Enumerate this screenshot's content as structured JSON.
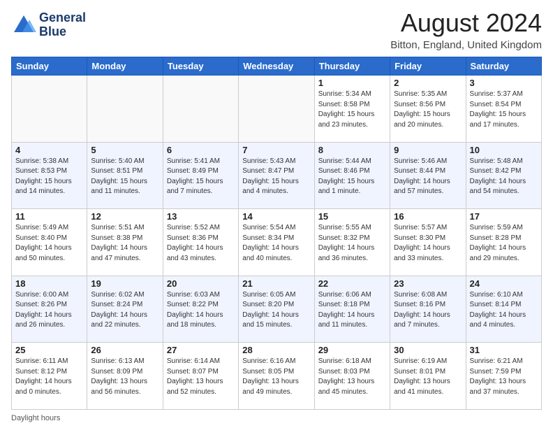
{
  "header": {
    "logo_line1": "General",
    "logo_line2": "Blue",
    "month_year": "August 2024",
    "location": "Bitton, England, United Kingdom"
  },
  "days_of_week": [
    "Sunday",
    "Monday",
    "Tuesday",
    "Wednesday",
    "Thursday",
    "Friday",
    "Saturday"
  ],
  "footer": {
    "daylight_label": "Daylight hours"
  },
  "weeks": [
    [
      {
        "day": "",
        "info": ""
      },
      {
        "day": "",
        "info": ""
      },
      {
        "day": "",
        "info": ""
      },
      {
        "day": "",
        "info": ""
      },
      {
        "day": "1",
        "info": "Sunrise: 5:34 AM\nSunset: 8:58 PM\nDaylight: 15 hours\nand 23 minutes."
      },
      {
        "day": "2",
        "info": "Sunrise: 5:35 AM\nSunset: 8:56 PM\nDaylight: 15 hours\nand 20 minutes."
      },
      {
        "day": "3",
        "info": "Sunrise: 5:37 AM\nSunset: 8:54 PM\nDaylight: 15 hours\nand 17 minutes."
      }
    ],
    [
      {
        "day": "4",
        "info": "Sunrise: 5:38 AM\nSunset: 8:53 PM\nDaylight: 15 hours\nand 14 minutes."
      },
      {
        "day": "5",
        "info": "Sunrise: 5:40 AM\nSunset: 8:51 PM\nDaylight: 15 hours\nand 11 minutes."
      },
      {
        "day": "6",
        "info": "Sunrise: 5:41 AM\nSunset: 8:49 PM\nDaylight: 15 hours\nand 7 minutes."
      },
      {
        "day": "7",
        "info": "Sunrise: 5:43 AM\nSunset: 8:47 PM\nDaylight: 15 hours\nand 4 minutes."
      },
      {
        "day": "8",
        "info": "Sunrise: 5:44 AM\nSunset: 8:46 PM\nDaylight: 15 hours\nand 1 minute."
      },
      {
        "day": "9",
        "info": "Sunrise: 5:46 AM\nSunset: 8:44 PM\nDaylight: 14 hours\nand 57 minutes."
      },
      {
        "day": "10",
        "info": "Sunrise: 5:48 AM\nSunset: 8:42 PM\nDaylight: 14 hours\nand 54 minutes."
      }
    ],
    [
      {
        "day": "11",
        "info": "Sunrise: 5:49 AM\nSunset: 8:40 PM\nDaylight: 14 hours\nand 50 minutes."
      },
      {
        "day": "12",
        "info": "Sunrise: 5:51 AM\nSunset: 8:38 PM\nDaylight: 14 hours\nand 47 minutes."
      },
      {
        "day": "13",
        "info": "Sunrise: 5:52 AM\nSunset: 8:36 PM\nDaylight: 14 hours\nand 43 minutes."
      },
      {
        "day": "14",
        "info": "Sunrise: 5:54 AM\nSunset: 8:34 PM\nDaylight: 14 hours\nand 40 minutes."
      },
      {
        "day": "15",
        "info": "Sunrise: 5:55 AM\nSunset: 8:32 PM\nDaylight: 14 hours\nand 36 minutes."
      },
      {
        "day": "16",
        "info": "Sunrise: 5:57 AM\nSunset: 8:30 PM\nDaylight: 14 hours\nand 33 minutes."
      },
      {
        "day": "17",
        "info": "Sunrise: 5:59 AM\nSunset: 8:28 PM\nDaylight: 14 hours\nand 29 minutes."
      }
    ],
    [
      {
        "day": "18",
        "info": "Sunrise: 6:00 AM\nSunset: 8:26 PM\nDaylight: 14 hours\nand 26 minutes."
      },
      {
        "day": "19",
        "info": "Sunrise: 6:02 AM\nSunset: 8:24 PM\nDaylight: 14 hours\nand 22 minutes."
      },
      {
        "day": "20",
        "info": "Sunrise: 6:03 AM\nSunset: 8:22 PM\nDaylight: 14 hours\nand 18 minutes."
      },
      {
        "day": "21",
        "info": "Sunrise: 6:05 AM\nSunset: 8:20 PM\nDaylight: 14 hours\nand 15 minutes."
      },
      {
        "day": "22",
        "info": "Sunrise: 6:06 AM\nSunset: 8:18 PM\nDaylight: 14 hours\nand 11 minutes."
      },
      {
        "day": "23",
        "info": "Sunrise: 6:08 AM\nSunset: 8:16 PM\nDaylight: 14 hours\nand 7 minutes."
      },
      {
        "day": "24",
        "info": "Sunrise: 6:10 AM\nSunset: 8:14 PM\nDaylight: 14 hours\nand 4 minutes."
      }
    ],
    [
      {
        "day": "25",
        "info": "Sunrise: 6:11 AM\nSunset: 8:12 PM\nDaylight: 14 hours\nand 0 minutes."
      },
      {
        "day": "26",
        "info": "Sunrise: 6:13 AM\nSunset: 8:09 PM\nDaylight: 13 hours\nand 56 minutes."
      },
      {
        "day": "27",
        "info": "Sunrise: 6:14 AM\nSunset: 8:07 PM\nDaylight: 13 hours\nand 52 minutes."
      },
      {
        "day": "28",
        "info": "Sunrise: 6:16 AM\nSunset: 8:05 PM\nDaylight: 13 hours\nand 49 minutes."
      },
      {
        "day": "29",
        "info": "Sunrise: 6:18 AM\nSunset: 8:03 PM\nDaylight: 13 hours\nand 45 minutes."
      },
      {
        "day": "30",
        "info": "Sunrise: 6:19 AM\nSunset: 8:01 PM\nDaylight: 13 hours\nand 41 minutes."
      },
      {
        "day": "31",
        "info": "Sunrise: 6:21 AM\nSunset: 7:59 PM\nDaylight: 13 hours\nand 37 minutes."
      }
    ]
  ]
}
